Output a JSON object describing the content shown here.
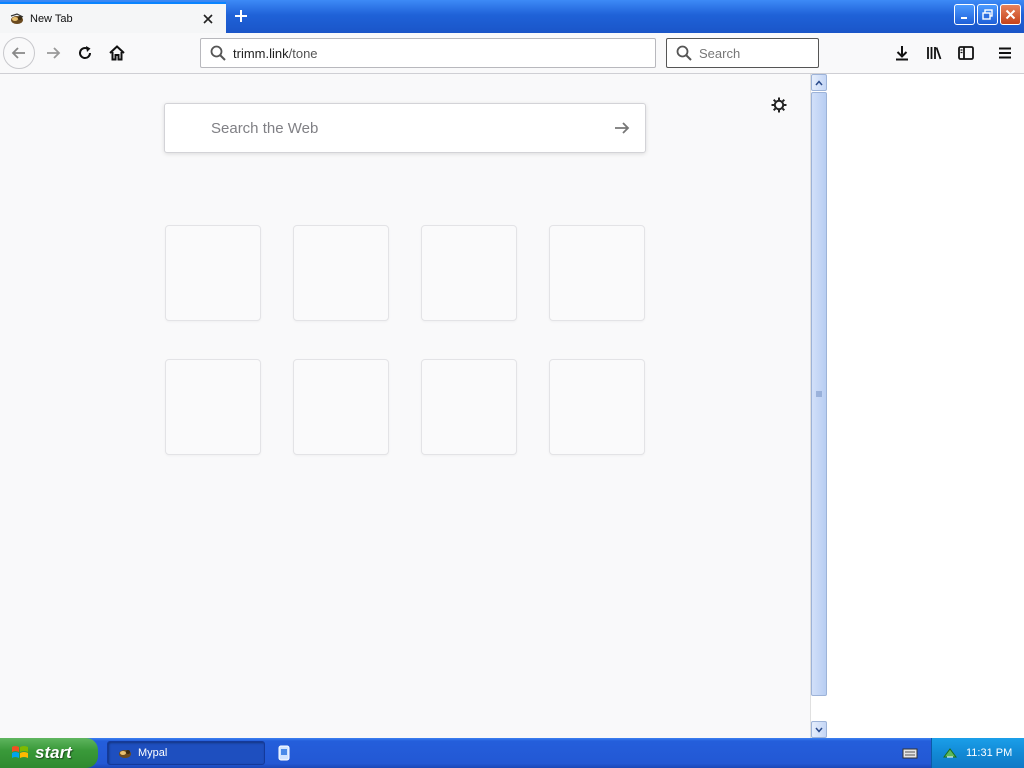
{
  "tab": {
    "title": "New Tab",
    "close_label": "×"
  },
  "newtab": {
    "label": "+"
  },
  "navbar": {
    "url_domain": "trimm.link",
    "url_path": "/tone",
    "search_placeholder": "Search"
  },
  "content": {
    "websearch_placeholder": "Search the Web",
    "tiles_rows": 2,
    "tiles_per_row": 4
  },
  "taskbar": {
    "start_label": "start",
    "task_label": "Mypal",
    "clock": "11:31 PM"
  },
  "icons": {
    "favicon": "mypal-icon",
    "back": "back-arrow-icon",
    "forward": "forward-arrow-icon",
    "reload": "reload-icon",
    "home": "home-icon",
    "url_search": "search-icon",
    "search": "search-icon",
    "downloads": "download-icon",
    "library": "library-icon",
    "sidebar": "sidebar-icon",
    "menu": "hamburger-menu-icon",
    "settings": "gear-icon",
    "go": "arrow-right-icon"
  },
  "colors": {
    "accent": "#0a84ff",
    "taskbar": "#245edb",
    "start": "#3a9a3a"
  }
}
